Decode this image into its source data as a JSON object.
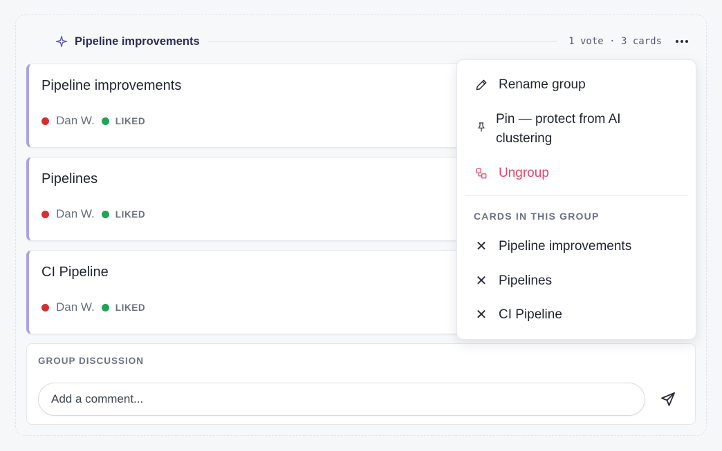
{
  "group": {
    "title": "Pipeline improvements",
    "meta": "1 vote · 3 cards"
  },
  "cards": [
    {
      "title": "Pipeline improvements",
      "author": "Dan W.",
      "reaction": "LIKED"
    },
    {
      "title": "Pipelines",
      "author": "Dan W.",
      "reaction": "LIKED"
    },
    {
      "title": "CI Pipeline",
      "author": "Dan W.",
      "reaction": "LIKED"
    }
  ],
  "discussion": {
    "label": "GROUP DISCUSSION",
    "placeholder": "Add a comment..."
  },
  "menu": {
    "rename": "Rename group",
    "pin": "Pin — protect from AI clustering",
    "ungroup": "Ungroup",
    "section_label": "CARDS IN THIS GROUP",
    "cards": [
      "Pipeline improvements",
      "Pipelines",
      "CI Pipeline"
    ]
  },
  "colors": {
    "accent": "#a9a3e0",
    "danger": "#e0456a",
    "author_dot": "#d22f2f",
    "reaction_dot": "#1fa456"
  },
  "icons": {
    "group": "sparkle-icon",
    "more": "more-horizontal-icon",
    "rename": "pencil-icon",
    "pin": "pin-icon",
    "ungroup": "ungroup-icon",
    "remove": "close-icon",
    "send": "send-icon"
  }
}
